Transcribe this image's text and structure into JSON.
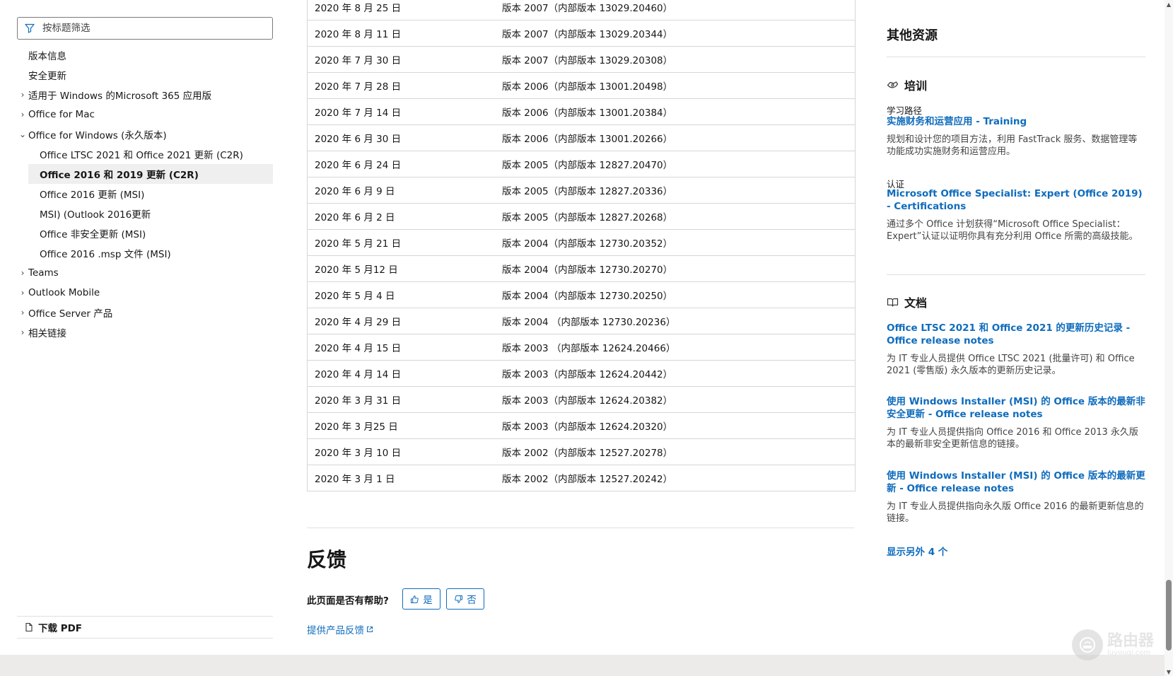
{
  "filter": {
    "placeholder": "按标题筛选"
  },
  "nav": {
    "items": [
      {
        "label": "版本信息",
        "level": 1,
        "chevron": "none"
      },
      {
        "label": "安全更新",
        "level": 1,
        "chevron": "none"
      },
      {
        "label": "适用于 Windows 的Microsoft 365 应用版",
        "level": 1,
        "chevron": "right"
      },
      {
        "label": "Office for Mac",
        "level": 1,
        "chevron": "right"
      },
      {
        "label": "Office for Windows (永久版本)",
        "level": 1,
        "chevron": "down"
      },
      {
        "label": "Office LTSC 2021 和 Office 2021 更新 (C2R)",
        "level": 2,
        "chevron": "none"
      },
      {
        "label": "Office 2016 和 2019 更新 (C2R)",
        "level": 2,
        "chevron": "none",
        "active": true
      },
      {
        "label": "Office 2016 更新 (MSI)",
        "level": 2,
        "chevron": "none"
      },
      {
        "label": "MSI) (Outlook 2016更新",
        "level": 2,
        "chevron": "none"
      },
      {
        "label": "Office 非安全更新 (MSI)",
        "level": 2,
        "chevron": "none"
      },
      {
        "label": "Office 2016 .msp 文件 (MSI)",
        "level": 2,
        "chevron": "none"
      },
      {
        "label": "Teams",
        "level": 1,
        "chevron": "right"
      },
      {
        "label": "Outlook Mobile",
        "level": 1,
        "chevron": "right"
      },
      {
        "label": "Office Server 产品",
        "level": 1,
        "chevron": "right"
      },
      {
        "label": "相关链接",
        "level": 1,
        "chevron": "right"
      }
    ],
    "download_pdf": "下载 PDF"
  },
  "table": {
    "rows": [
      [
        "2020 年 8 月 25 日",
        "版本 2007（内部版本 13029.20460）"
      ],
      [
        "2020 年 8 月 11 日",
        "版本 2007（内部版本 13029.20344）"
      ],
      [
        "2020 年 7 月 30 日",
        "版本 2007（内部版本 13029.20308）"
      ],
      [
        "2020 年 7 月 28 日",
        "版本 2006（内部版本 13001.20498）"
      ],
      [
        "2020 年 7 月 14 日",
        "版本 2006（内部版本 13001.20384）"
      ],
      [
        "2020 年 6 月 30 日",
        "版本 2006（内部版本 13001.20266）"
      ],
      [
        "2020 年 6 月 24 日",
        "版本 2005（内部版本 12827.20470）"
      ],
      [
        "2020 年 6 月 9 日",
        "版本 2005（内部版本 12827.20336）"
      ],
      [
        "2020 年 6 月 2 日",
        "版本 2005（内部版本 12827.20268）"
      ],
      [
        "2020 年 5 月 21 日",
        "版本 2004（内部版本 12730.20352）"
      ],
      [
        "2020 年 5 月12 日",
        "版本 2004（内部版本 12730.20270）"
      ],
      [
        "2020 年 5 月 4 日",
        "版本 2004（内部版本 12730.20250）"
      ],
      [
        "2020 年 4 月 29 日",
        "版本 2004 （内部版本 12730.20236）"
      ],
      [
        "2020 年 4 月 15 日",
        "版本 2003 （内部版本 12624.20466）"
      ],
      [
        "2020 年 4 月 14 日",
        "版本 2003（内部版本 12624.20442）"
      ],
      [
        "2020 年 3 月 31 日",
        "版本 2003（内部版本 12624.20382）"
      ],
      [
        "2020 年 3 月25 日",
        "版本 2003（内部版本 12624.20320）"
      ],
      [
        "2020 年 3 月 10 日",
        "版本 2002（内部版本 12527.20278）"
      ],
      [
        "2020 年 3 月 1 日",
        "版本 2002（内部版本 12527.20242）"
      ]
    ]
  },
  "feedback": {
    "title": "反馈",
    "question": "此页面是否有帮助?",
    "yes": "是",
    "no": "否",
    "product_feedback": "提供产品反馈"
  },
  "rail": {
    "title": "其他资源",
    "training": {
      "heading": "培训",
      "kind1": "学习路径",
      "link1": "实施财务和运营应用 - Training",
      "desc1": "规划和设计您的项目方法，利用 FastTrack 服务、数据管理等功能成功实施财务和运营应用。",
      "kind2": "认证",
      "link2": "Microsoft Office Specialist: Expert (Office 2019) - Certifications",
      "desc2": "通过多个 Office 计划获得“Microsoft Office Specialist：Expert”认证以证明你具有充分利用 Office 所需的高级技能。"
    },
    "docs": {
      "heading": "文档",
      "link1": "Office LTSC 2021 和 Office 2021 的更新历史记录 - Office release notes",
      "desc1": "为 IT 专业人员提供 Office LTSC 2021 (批量许可) 和 Office 2021 (零售版) 永久版本的更新历史记录。",
      "link2": "使用 Windows Installer (MSI) 的 Office 版本的最新非安全更新 - Office release notes",
      "desc2": "为 IT 专业人员提供指向 Office 2016 和 Office 2013 永久版本的最新非安全更新信息的链接。",
      "link3": "使用 Windows Installer (MSI) 的 Office 版本的最新更新 - Office release notes",
      "desc3": "为 IT 专业人员提供指向永久版 Office 2016 的最新更新信息的链接。",
      "show_more": "显示另外 4 个"
    }
  },
  "watermark": {
    "text": "路由器",
    "sub": "luyouqi.com"
  },
  "colors": {
    "link": "#0f6cbd",
    "border": "#d6d6d6",
    "footer": "#ecebe9"
  }
}
